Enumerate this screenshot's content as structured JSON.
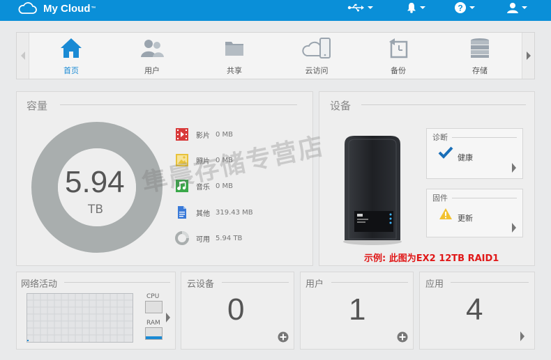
{
  "header": {
    "brand": "My Cloud",
    "trademark": "™",
    "icons": [
      "usb-icon",
      "bell-icon",
      "help-icon",
      "user-icon"
    ]
  },
  "nav": {
    "items": [
      {
        "label": "首页",
        "icon": "home-icon",
        "active": true
      },
      {
        "label": "用户",
        "icon": "users-icon",
        "active": false
      },
      {
        "label": "共享",
        "icon": "folder-icon",
        "active": false
      },
      {
        "label": "云访问",
        "icon": "cloud-device-icon",
        "active": false
      },
      {
        "label": "备份",
        "icon": "backup-icon",
        "active": false
      },
      {
        "label": "存储",
        "icon": "storage-icon",
        "active": false
      }
    ]
  },
  "capacity": {
    "title": "容量",
    "total_value": "5.94",
    "total_unit": "TB",
    "legend": [
      {
        "name": "影片",
        "value": "0 MB",
        "color": "#d83a3a"
      },
      {
        "name": "照片",
        "value": "0 MB",
        "color": "#e8c23a"
      },
      {
        "name": "音乐",
        "value": "0 MB",
        "color": "#3aa84a"
      },
      {
        "name": "其他",
        "value": "319.43 MB",
        "color": "#3a7ad8"
      },
      {
        "name": "可用",
        "value": "5.94 TB",
        "color": "#a9aeae"
      }
    ]
  },
  "device": {
    "title": "设备",
    "diagnostics": {
      "title": "诊断",
      "status": "健康"
    },
    "firmware": {
      "title": "固件",
      "status": "更新"
    },
    "note": "示例: 此图为EX2 12TB RAID1"
  },
  "network": {
    "title": "网络活动",
    "cpu_label": "CPU",
    "ram_label": "RAM"
  },
  "cloud_devices": {
    "title": "云设备",
    "count": "0"
  },
  "users": {
    "title": "用户",
    "count": "1"
  },
  "apps": {
    "title": "应用",
    "count": "4"
  },
  "watermark": "隼晨存储专营店",
  "colors": {
    "header": "#0a8fd8",
    "accent": "#1a8ad4",
    "donut": "#a9aeae"
  }
}
